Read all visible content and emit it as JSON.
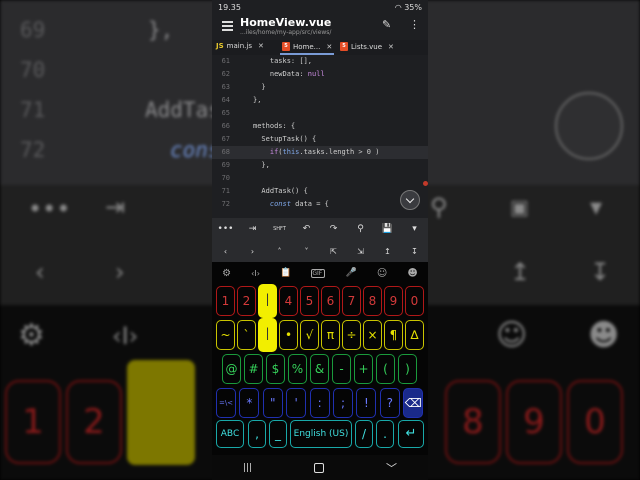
{
  "status": {
    "time": "19.35",
    "battery": "35%"
  },
  "app": {
    "title": "HomeView.vue",
    "path": "...iles/home/my-app/src/views/",
    "pen_icon": "pencil-icon",
    "more_icon": "kebab-icon"
  },
  "tabs": [
    {
      "icon": "JS",
      "label": "main.js"
    },
    {
      "icon": "5",
      "label": "Home..."
    },
    {
      "icon": "5",
      "label": "Lists.vue"
    }
  ],
  "code": [
    {
      "n": "61",
      "text": "    tasks: [],"
    },
    {
      "n": "62",
      "text": "    newData: null"
    },
    {
      "n": "63",
      "text": "  }"
    },
    {
      "n": "64",
      "text": "},"
    },
    {
      "n": "65",
      "text": ""
    },
    {
      "n": "66",
      "text": "methods: {"
    },
    {
      "n": "67",
      "text": "  SetupTask() {"
    },
    {
      "n": "68",
      "text": "    if(this.tasks.length > 0 )"
    },
    {
      "n": "69",
      "text": "  },"
    },
    {
      "n": "70",
      "text": ""
    },
    {
      "n": "71",
      "text": "  AddTask() {"
    },
    {
      "n": "72",
      "text": "    const data = {"
    }
  ],
  "toolbar1": [
    "•••",
    "⇥",
    "SHFT",
    "↶",
    "↷",
    "⚲",
    "💾",
    "▾"
  ],
  "toolbar2": [
    "‹",
    "›",
    "˄",
    "˅",
    "⇱",
    "⇲",
    "↥",
    "↧"
  ],
  "keyboard": {
    "top": [
      "⚙",
      "‹I›",
      "📋",
      "GIF",
      "🎤",
      "☺",
      "☻"
    ],
    "row1": [
      "1",
      "2",
      "|",
      "4",
      "5",
      "6",
      "7",
      "8",
      "9",
      "0"
    ],
    "row2": [
      "~",
      "`",
      "|",
      "•",
      "√",
      "π",
      "÷",
      "×",
      "¶",
      "∆"
    ],
    "row3": [
      "@",
      "#",
      "$",
      "%",
      "&",
      "-",
      "+",
      "(",
      ")"
    ],
    "row4": [
      "=\\<",
      "*",
      "\"",
      "'",
      ":",
      ";",
      "!",
      "?",
      "⌫"
    ],
    "row5": {
      "abc": "ABC",
      "comma": ",",
      "underscore": "_",
      "space": "English (US)",
      "slash": "/",
      "dot": ".",
      "enter": "↵"
    }
  },
  "nav": [
    "|||",
    "○",
    "﹀"
  ],
  "background": {
    "line_numbers": [
      "69",
      "70",
      "71",
      "72"
    ],
    "code": [
      "},",
      "AddTas",
      "cons"
    ],
    "digits": [
      "1",
      "2",
      "8",
      "9",
      "0"
    ]
  }
}
